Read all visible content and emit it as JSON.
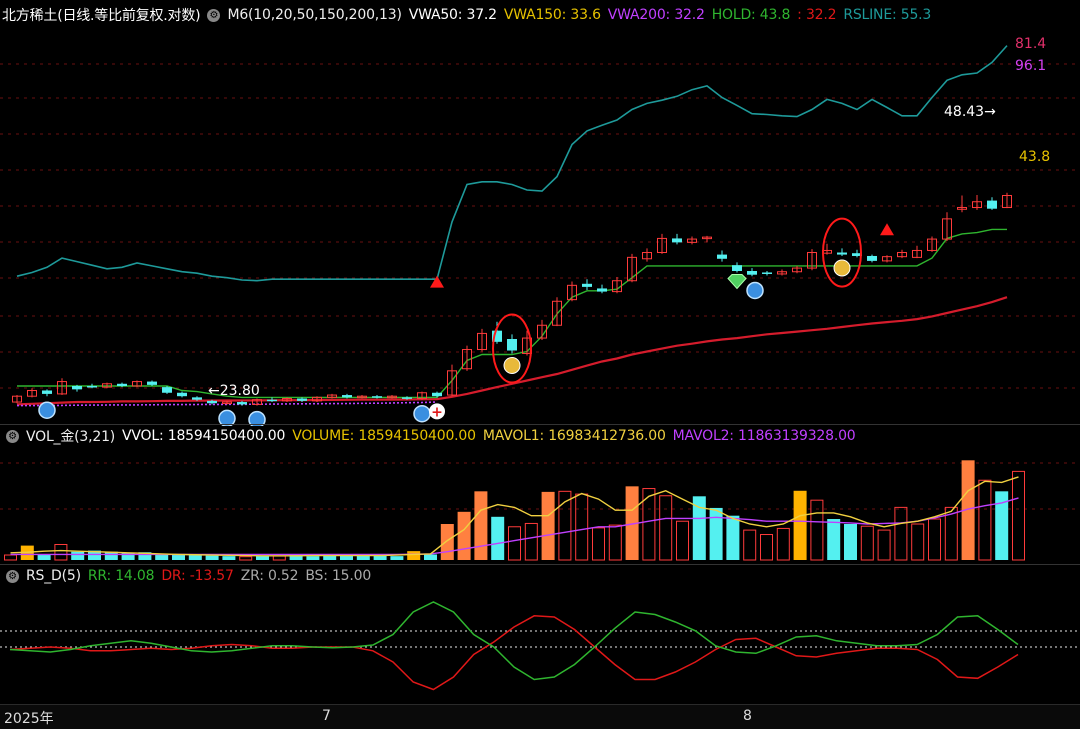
{
  "main_header": {
    "title": "北方稀土(日线.等比前复权.对数)",
    "indicator": "M6(10,20,50,150,200,13)",
    "vwa50": "VWA50: 37.2",
    "vwa150": "VWA150: 33.6",
    "vwa200": "VWA200: 32.2",
    "hold": "HOLD: 43.8",
    "hold2": ": 32.2",
    "rsline": "RSLINE: 55.3"
  },
  "price_labels": {
    "right_top": "81.4",
    "right_second": "96.1",
    "right_hold": "43.8",
    "high_mark": "48.43",
    "low_mark": "23.80",
    "low_arrow": "←"
  },
  "vol_header": {
    "title": "VOL_金(3,21)",
    "vvol": "VVOL: 18594150400.00",
    "volume": "VOLUME: 18594150400.00",
    "mavol1": "MAVOL1: 16983412736.00",
    "mavol2": "MAVOL2: 11863139328.00"
  },
  "rs_header": {
    "title": "RS_D(5)",
    "rr": "RR: 14.08",
    "dr": "DR: -13.57",
    "zr": "ZR: 0.52",
    "bs": "BS: 15.00"
  },
  "x_axis": {
    "year": "2025年",
    "m7": "7",
    "m8": "8"
  },
  "colors": {
    "up": "#ff3b3b",
    "down": "#54f0f0",
    "ma_green": "#2fb52f",
    "vwa200": "#d51c2c",
    "rsline": "#1e9a9a",
    "vwa150": "#e6c200",
    "purple": "#c040ff",
    "rr": "#2fb52f",
    "dr": "#e01818"
  },
  "chart_data": {
    "type": "candlestick",
    "ylabel": "",
    "candles": [
      {
        "o": 23.5,
        "c": 24.0,
        "h": 24.1,
        "l": 23.4
      },
      {
        "o": 24.0,
        "c": 24.5,
        "h": 24.7,
        "l": 23.9
      },
      {
        "o": 24.5,
        "c": 24.2,
        "h": 24.6,
        "l": 24.0
      },
      {
        "o": 24.2,
        "c": 25.3,
        "h": 25.6,
        "l": 24.1
      },
      {
        "o": 24.9,
        "c": 24.6,
        "h": 25.0,
        "l": 24.4
      },
      {
        "o": 24.9,
        "c": 24.8,
        "h": 25.1,
        "l": 24.7
      },
      {
        "o": 24.8,
        "c": 25.1,
        "h": 25.2,
        "l": 24.7
      },
      {
        "o": 25.1,
        "c": 24.9,
        "h": 25.2,
        "l": 24.8
      },
      {
        "o": 24.9,
        "c": 25.3,
        "h": 25.4,
        "l": 24.8
      },
      {
        "o": 25.3,
        "c": 25.0,
        "h": 25.4,
        "l": 24.9
      },
      {
        "o": 24.8,
        "c": 24.3,
        "h": 24.9,
        "l": 24.2
      },
      {
        "o": 24.3,
        "c": 24.0,
        "h": 24.4,
        "l": 23.9
      },
      {
        "o": 23.9,
        "c": 23.7,
        "h": 24.0,
        "l": 23.6
      },
      {
        "o": 23.6,
        "c": 23.4,
        "h": 23.7,
        "l": 23.3
      },
      {
        "o": 23.4,
        "c": 23.5,
        "h": 23.6,
        "l": 23.3
      },
      {
        "o": 23.5,
        "c": 23.3,
        "h": 23.6,
        "l": 23.2
      },
      {
        "o": 23.3,
        "c": 23.7,
        "h": 23.8,
        "l": 23.2
      },
      {
        "o": 23.7,
        "c": 23.6,
        "h": 23.9,
        "l": 23.5
      },
      {
        "o": 23.6,
        "c": 23.8,
        "h": 23.9,
        "l": 23.5
      },
      {
        "o": 23.8,
        "c": 23.6,
        "h": 23.9,
        "l": 23.5
      },
      {
        "o": 23.6,
        "c": 23.9,
        "h": 24.0,
        "l": 23.5
      },
      {
        "o": 23.9,
        "c": 24.1,
        "h": 24.2,
        "l": 23.8
      },
      {
        "o": 24.1,
        "c": 23.9,
        "h": 24.2,
        "l": 23.8
      },
      {
        "o": 23.9,
        "c": 24.0,
        "h": 24.1,
        "l": 23.8
      },
      {
        "o": 24.0,
        "c": 23.9,
        "h": 24.1,
        "l": 23.8
      },
      {
        "o": 23.9,
        "c": 24.0,
        "h": 24.1,
        "l": 23.8
      },
      {
        "o": 23.9,
        "c": 23.8,
        "h": 24.0,
        "l": 23.7
      },
      {
        "o": 23.8,
        "c": 24.3,
        "h": 24.4,
        "l": 23.7
      },
      {
        "o": 24.3,
        "c": 24.0,
        "h": 24.4,
        "l": 23.9
      },
      {
        "o": 24.1,
        "c": 26.3,
        "h": 26.9,
        "l": 24.0
      },
      {
        "o": 26.5,
        "c": 28.4,
        "h": 28.8,
        "l": 26.3
      },
      {
        "o": 28.4,
        "c": 30.1,
        "h": 30.6,
        "l": 28.2
      },
      {
        "o": 30.4,
        "c": 29.2,
        "h": 31.4,
        "l": 29.0
      },
      {
        "o": 29.5,
        "c": 28.3,
        "h": 30.0,
        "l": 28.0
      },
      {
        "o": 28.0,
        "c": 29.6,
        "h": 30.4,
        "l": 27.8
      },
      {
        "o": 29.6,
        "c": 31.0,
        "h": 31.6,
        "l": 29.4
      },
      {
        "o": 31.0,
        "c": 33.8,
        "h": 34.3,
        "l": 30.9
      },
      {
        "o": 34.0,
        "c": 35.8,
        "h": 36.3,
        "l": 33.8
      },
      {
        "o": 36.0,
        "c": 35.6,
        "h": 36.6,
        "l": 35.2
      },
      {
        "o": 35.4,
        "c": 35.0,
        "h": 35.9,
        "l": 34.8
      },
      {
        "o": 35.0,
        "c": 36.4,
        "h": 36.9,
        "l": 34.8
      },
      {
        "o": 36.4,
        "c": 39.6,
        "h": 40.1,
        "l": 36.2
      },
      {
        "o": 39.4,
        "c": 40.3,
        "h": 40.9,
        "l": 39.0
      },
      {
        "o": 40.3,
        "c": 42.4,
        "h": 43.1,
        "l": 40.1
      },
      {
        "o": 42.4,
        "c": 41.8,
        "h": 43.1,
        "l": 41.5
      },
      {
        "o": 41.8,
        "c": 42.3,
        "h": 42.7,
        "l": 41.5
      },
      {
        "o": 42.4,
        "c": 42.6,
        "h": 42.8,
        "l": 41.8
      },
      {
        "o": 40.0,
        "c": 39.4,
        "h": 40.6,
        "l": 39.0
      },
      {
        "o": 38.5,
        "c": 37.7,
        "h": 38.9,
        "l": 37.5
      },
      {
        "o": 37.7,
        "c": 37.2,
        "h": 38.1,
        "l": 37.0
      },
      {
        "o": 37.5,
        "c": 37.3,
        "h": 37.7,
        "l": 37.1
      },
      {
        "o": 37.3,
        "c": 37.6,
        "h": 37.9,
        "l": 37.1
      },
      {
        "o": 37.6,
        "c": 38.1,
        "h": 38.4,
        "l": 37.4
      },
      {
        "o": 38.1,
        "c": 40.3,
        "h": 40.8,
        "l": 37.8
      },
      {
        "o": 40.2,
        "c": 40.6,
        "h": 41.6,
        "l": 40.0
      },
      {
        "o": 40.3,
        "c": 40.0,
        "h": 40.9,
        "l": 39.8
      },
      {
        "o": 40.2,
        "c": 39.8,
        "h": 40.7,
        "l": 39.6
      },
      {
        "o": 39.8,
        "c": 39.1,
        "h": 40.0,
        "l": 38.9
      },
      {
        "o": 39.1,
        "c": 39.7,
        "h": 39.9,
        "l": 38.9
      },
      {
        "o": 39.7,
        "c": 40.3,
        "h": 40.7,
        "l": 39.5
      },
      {
        "o": 39.6,
        "c": 40.6,
        "h": 41.3,
        "l": 39.5
      },
      {
        "o": 40.6,
        "c": 42.3,
        "h": 42.7,
        "l": 40.4
      },
      {
        "o": 42.3,
        "c": 45.5,
        "h": 46.6,
        "l": 42.0
      },
      {
        "o": 47.1,
        "c": 47.4,
        "h": 49.5,
        "l": 46.6
      },
      {
        "o": 47.4,
        "c": 48.4,
        "h": 49.6,
        "l": 47.0
      },
      {
        "o": 48.6,
        "c": 47.2,
        "h": 49.2,
        "l": 47.0
      },
      {
        "o": 47.4,
        "c": 49.5,
        "h": 50.0,
        "l": 47.3
      }
    ],
    "hold_line": [
      24.9,
      24.9,
      24.9,
      24.9,
      24.9,
      24.9,
      24.9,
      24.9,
      24.9,
      24.9,
      24.9,
      24.5,
      24.4,
      24.2,
      24.0,
      23.9,
      23.9,
      23.9,
      23.9,
      23.9,
      23.9,
      23.9,
      23.9,
      23.9,
      23.9,
      23.9,
      23.9,
      23.9,
      23.9,
      25.4,
      27.3,
      27.9,
      27.9,
      27.9,
      28.2,
      29.8,
      32.3,
      34.3,
      35.1,
      35.1,
      35.3,
      36.8,
      38.4,
      38.4,
      38.4,
      38.4,
      38.4,
      38.4,
      38.4,
      38.4,
      38.4,
      38.4,
      38.4,
      38.4,
      38.4,
      38.4,
      38.4,
      38.4,
      38.4,
      38.4,
      38.4,
      39.5,
      42.4,
      43.1,
      43.3,
      43.8,
      43.8
    ],
    "vwa200_line": [
      23.3,
      23.35,
      23.4,
      23.45,
      23.5,
      23.5,
      23.52,
      23.55,
      23.55,
      23.57,
      23.6,
      23.6,
      23.62,
      23.62,
      23.63,
      23.63,
      23.64,
      23.65,
      23.66,
      23.66,
      23.67,
      23.68,
      23.69,
      23.7,
      23.7,
      23.71,
      23.72,
      23.73,
      23.75,
      23.95,
      24.2,
      24.5,
      24.8,
      25.1,
      25.4,
      25.7,
      26.0,
      26.4,
      26.8,
      27.2,
      27.5,
      27.9,
      28.2,
      28.5,
      28.8,
      29.0,
      29.25,
      29.45,
      29.6,
      29.8,
      30.0,
      30.15,
      30.3,
      30.45,
      30.6,
      30.8,
      31.0,
      31.2,
      31.35,
      31.5,
      31.7,
      32.0,
      32.4,
      32.8,
      33.2,
      33.7,
      34.3
    ],
    "purple_line": [
      23.2,
      23.2,
      23.21,
      23.22,
      23.23,
      23.24,
      23.25,
      23.26,
      23.26,
      23.27,
      23.28,
      23.28,
      23.29,
      23.3,
      23.3,
      23.31,
      23.32,
      23.33,
      23.34,
      23.35,
      23.36,
      23.37,
      23.38,
      23.39,
      23.4,
      23.42,
      23.44,
      23.46,
      23.5
    ],
    "rsline_line": [
      37.0,
      37.5,
      38.2,
      39.5,
      39.0,
      38.5,
      38.0,
      38.2,
      38.8,
      38.4,
      38.0,
      37.6,
      37.4,
      37.0,
      36.8,
      36.5,
      36.4,
      36.6,
      36.6,
      36.6,
      36.6,
      36.6,
      36.6,
      36.6,
      36.6,
      36.6,
      36.6,
      36.6,
      36.6,
      45.0,
      51.5,
      52.0,
      52.0,
      51.5,
      50.5,
      50.3,
      53.0,
      59.5,
      62.5,
      63.8,
      65.0,
      67.5,
      69.0,
      69.8,
      70.8,
      72.5,
      73.5,
      70.5,
      68.5,
      66.5,
      66.3,
      66.0,
      65.8,
      67.5,
      70.0,
      69.0,
      67.5,
      70.0,
      68.0,
      66.0,
      66.0,
      70.5,
      75.0,
      76.5,
      77.0,
      80.0,
      85.0
    ],
    "volume": [
      {
        "v": 0.9,
        "t": "up"
      },
      {
        "v": 2.6,
        "t": "gold"
      },
      {
        "v": 0.9,
        "t": "down"
      },
      {
        "v": 2.8,
        "t": "up"
      },
      {
        "v": 1.5,
        "t": "down"
      },
      {
        "v": 1.7,
        "t": "down"
      },
      {
        "v": 1.5,
        "t": "down"
      },
      {
        "v": 1.3,
        "t": "down"
      },
      {
        "v": 1.4,
        "t": "down"
      },
      {
        "v": 1.0,
        "t": "down"
      },
      {
        "v": 1.1,
        "t": "down"
      },
      {
        "v": 0.9,
        "t": "down"
      },
      {
        "v": 0.8,
        "t": "down"
      },
      {
        "v": 0.7,
        "t": "down"
      },
      {
        "v": 0.6,
        "t": "up"
      },
      {
        "v": 0.7,
        "t": "down"
      },
      {
        "v": 0.7,
        "t": "up"
      },
      {
        "v": 0.9,
        "t": "down"
      },
      {
        "v": 0.7,
        "t": "down"
      },
      {
        "v": 0.8,
        "t": "down"
      },
      {
        "v": 0.9,
        "t": "down"
      },
      {
        "v": 0.8,
        "t": "down"
      },
      {
        "v": 0.8,
        "t": "down"
      },
      {
        "v": 0.7,
        "t": "down"
      },
      {
        "v": 1.6,
        "t": "gold"
      },
      {
        "v": 1.0,
        "t": "down"
      },
      {
        "v": 6.5,
        "t": "orange"
      },
      {
        "v": 8.7,
        "t": "orange"
      },
      {
        "v": 12.4,
        "t": "orange"
      },
      {
        "v": 7.8,
        "t": "down"
      },
      {
        "v": 6.0,
        "t": "up"
      },
      {
        "v": 6.6,
        "t": "up"
      },
      {
        "v": 12.3,
        "t": "orange"
      },
      {
        "v": 12.4,
        "t": "up"
      },
      {
        "v": 11.9,
        "t": "up"
      },
      {
        "v": 5.8,
        "t": "up"
      },
      {
        "v": 6.3,
        "t": "up"
      },
      {
        "v": 13.3,
        "t": "orange"
      },
      {
        "v": 12.9,
        "t": "up"
      },
      {
        "v": 11.6,
        "t": "up"
      },
      {
        "v": 7.0,
        "t": "up"
      },
      {
        "v": 11.5,
        "t": "down"
      },
      {
        "v": 9.4,
        "t": "down"
      },
      {
        "v": 8.0,
        "t": "down"
      },
      {
        "v": 5.4,
        "t": "up"
      },
      {
        "v": 4.6,
        "t": "up"
      },
      {
        "v": 5.7,
        "t": "up"
      },
      {
        "v": 12.5,
        "t": "gold"
      },
      {
        "v": 10.8,
        "t": "up"
      },
      {
        "v": 7.4,
        "t": "down"
      },
      {
        "v": 6.5,
        "t": "down"
      },
      {
        "v": 6.1,
        "t": "up"
      },
      {
        "v": 5.4,
        "t": "up"
      },
      {
        "v": 9.5,
        "t": "up"
      },
      {
        "v": 6.5,
        "t": "up"
      },
      {
        "v": 7.4,
        "t": "up"
      },
      {
        "v": 9.5,
        "t": "up"
      },
      {
        "v": 18.0,
        "t": "orange"
      },
      {
        "v": 14.4,
        "t": "up"
      },
      {
        "v": 12.4,
        "t": "down"
      },
      {
        "v": 16.0,
        "t": "up"
      }
    ],
    "mavol1": [
      1.3,
      1.4,
      1.6,
      1.7,
      1.6,
      1.5,
      1.4,
      1.3,
      1.2,
      1.1,
      1.0,
      0.95,
      0.9,
      0.85,
      0.8,
      0.75,
      0.75,
      0.75,
      0.8,
      0.8,
      0.8,
      0.8,
      0.8,
      0.9,
      1.0,
      1.1,
      3.5,
      5.5,
      9.0,
      10.0,
      9.5,
      8.0,
      8.0,
      10.5,
      12.0,
      11.0,
      9.0,
      9.0,
      11.5,
      12.5,
      11.0,
      9.5,
      9.0,
      7.5,
      6.5,
      6.0,
      6.5,
      8.0,
      8.5,
      8.5,
      7.8,
      6.7,
      6.0,
      6.6,
      7.0,
      7.8,
      8.8,
      12.5,
      14.2,
      14.0,
      15.0
    ],
    "mavol2": [
      1.0,
      1.0,
      1.0,
      1.0,
      1.0,
      1.0,
      1.0,
      1.0,
      1.0,
      1.0,
      1.0,
      1.0,
      1.0,
      1.0,
      1.0,
      1.0,
      1.0,
      1.0,
      1.0,
      1.0,
      1.0,
      1.0,
      1.0,
      1.0,
      1.05,
      1.1,
      1.5,
      2.0,
      2.5,
      3.0,
      3.5,
      4.0,
      4.5,
      5.0,
      5.5,
      6.0,
      6.0,
      6.5,
      7.0,
      7.5,
      7.5,
      7.5,
      7.7,
      7.5,
      7.3,
      7.0,
      7.0,
      7.0,
      6.9,
      6.8,
      6.7,
      6.5,
      6.6,
      6.7,
      7.0,
      7.6,
      8.3,
      9.2,
      9.8,
      10.3,
      11.2
    ],
    "rr": [
      -1.0,
      -1.5,
      -2.0,
      -1.0,
      0.5,
      1.5,
      2.5,
      1.5,
      0.0,
      -1.5,
      -2.0,
      -1.5,
      -0.5,
      0.5,
      0.5,
      0.0,
      -0.3,
      0.0,
      0.8,
      5.0,
      14.0,
      18.0,
      14.0,
      5.0,
      0.0,
      -8.0,
      -13.0,
      -12.0,
      -7.0,
      0.0,
      7.5,
      14.0,
      13.0,
      10.0,
      6.5,
      0.5,
      -2.0,
      -2.5,
      0.5,
      4.0,
      4.5,
      2.5,
      1.5,
      0.5,
      0.5,
      1.0,
      5.0,
      12.0,
      12.5,
      7.0,
      1.0
    ],
    "dr": [
      -1.0,
      -0.5,
      0.0,
      -0.5,
      -1.5,
      -1.5,
      -1.0,
      -0.5,
      -1.0,
      -0.5,
      0.5,
      1.0,
      0.5,
      -0.5,
      -0.5,
      0.0,
      0.0,
      0.0,
      -1.5,
      -6.0,
      -14.0,
      -17.0,
      -12.0,
      -3.0,
      2.0,
      8.0,
      12.5,
      12.0,
      7.0,
      0.0,
      -7.0,
      -13.0,
      -13.0,
      -10.0,
      -6.0,
      -1.0,
      3.0,
      3.5,
      0.0,
      -3.5,
      -4.0,
      -2.5,
      -1.5,
      -0.5,
      -0.5,
      -1.0,
      -5.0,
      -12.0,
      -12.5,
      -8.0,
      -3.0
    ],
    "buy_markers": [
      2,
      14,
      16,
      27
    ],
    "cross_marker": 28,
    "bag_markers": [
      33,
      55
    ],
    "diamond_marker": 48,
    "triangle_markers": [
      28,
      58
    ],
    "rr_range": [
      -20,
      20
    ]
  }
}
